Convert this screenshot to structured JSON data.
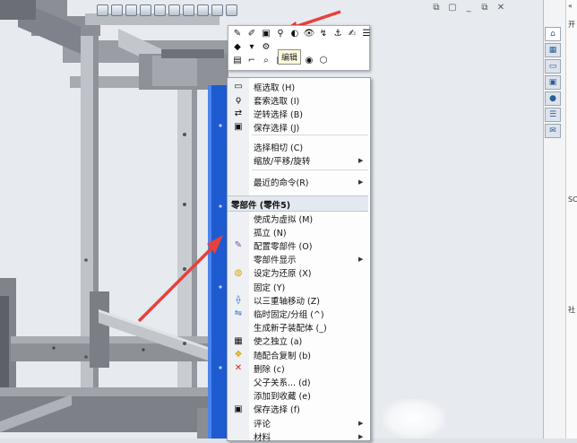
{
  "window_controls": [
    "⧉",
    "▢",
    "_",
    "⧉",
    "✕"
  ],
  "headsup_icons": [
    "zoom-to-fit-icon",
    "zoom-area-icon",
    "previous-view-icon",
    "section-view-icon",
    "view-orientation-icon",
    "display-style-icon",
    "hide-show-icon",
    "edit-appearance-icon",
    "apply-scene-icon",
    "view-settings-icon"
  ],
  "context_toolbar": {
    "tooltip": "编辑"
  },
  "right_panel": {
    "tabs": [
      "home-icon",
      "design-library-icon",
      "file-explorer-icon",
      "view-palette-icon",
      "appearances-icon",
      "custom-properties-icon",
      "forum-icon"
    ],
    "side_labels": [
      "开",
      "SC",
      "社"
    ]
  },
  "menu": {
    "items_top": [
      {
        "icon": "box-select-icon",
        "label": "框选取 (H)"
      },
      {
        "icon": "lasso-select-icon",
        "label": "套索选取 (I)"
      },
      {
        "icon": "invert-select-icon",
        "label": "逆转选择 (B)"
      },
      {
        "icon": "save-select-icon",
        "label": "保存选择 (J)"
      }
    ],
    "items_mid": [
      {
        "label": "选择相切 (C)"
      },
      {
        "label": "缩放/平移/旋转",
        "submenu": true
      }
    ],
    "items_recent": [
      {
        "label": "最近的命令(R)",
        "submenu": true
      }
    ],
    "section_header": "零部件 (零件5)",
    "items_component": [
      {
        "icon": "",
        "label": "使成为虚拟 (M)"
      },
      {
        "icon": "",
        "label": "孤立 (N)"
      },
      {
        "icon": "configure-icon",
        "label": "配置零部件 (O)"
      },
      {
        "icon": "",
        "label": "零部件显示",
        "submenu": true
      },
      {
        "icon": "restore-icon",
        "label": "设定为还原 (X)"
      },
      {
        "icon": "",
        "label": "固定 (Y)"
      },
      {
        "icon": "triad-move-icon",
        "label": "以三重轴移动 (Z)"
      },
      {
        "icon": "temp-fix-icon",
        "label": "临时固定/分组 (^)"
      },
      {
        "icon": "",
        "label": "生成新子装配体 (_)"
      },
      {
        "icon": "dissolve-icon",
        "label": "使之独立 (a)"
      },
      {
        "icon": "copy-mates-icon",
        "label": "随配合复制 (b)"
      },
      {
        "icon": "delete-icon",
        "label": "删除 (c)"
      },
      {
        "icon": "",
        "label": "父子关系... (d)"
      },
      {
        "icon": "",
        "label": "添加到收藏 (e)"
      },
      {
        "icon": "save-icon",
        "label": "保存选择 (f)"
      },
      {
        "icon": "",
        "label": "评论",
        "submenu": true
      },
      {
        "icon": "",
        "label": "材料",
        "submenu": true
      }
    ]
  },
  "colors": {
    "selection_blue": "#1e5bd0",
    "annotation_red": "#e8403a",
    "frame_metal": "#9c9fa6"
  }
}
